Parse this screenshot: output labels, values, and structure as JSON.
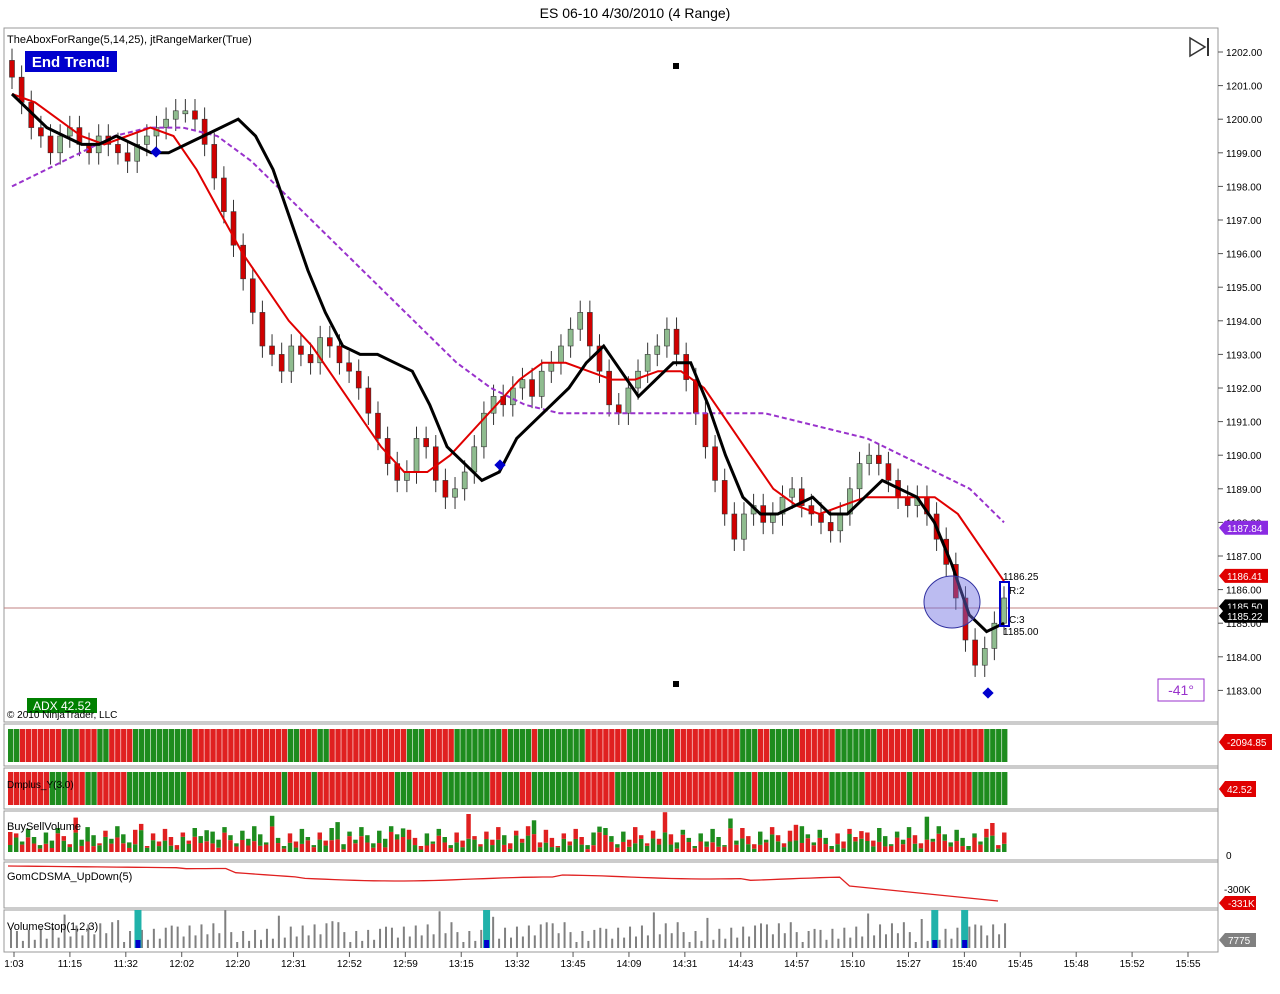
{
  "window": {
    "title": "ES 06-10  4/30/2010 (4 Range)"
  },
  "main_panel": {
    "indicator_label": "TheAboxForRange(5,14,25), jtRangeMarker(True)",
    "end_trend_badge": "End Trend!",
    "adx_badge": "ADX 42.52",
    "copyright": "© 2010 NinjaTrader, LLC",
    "angle_label": "-41°",
    "range_box": {
      "high_label": "1186.25",
      "r_label": "R:2",
      "c_label": "C:3",
      "low_label": "1185.00"
    }
  },
  "price_axis": {
    "ticks": [
      "1202.00",
      "1201.00",
      "1200.00",
      "1199.00",
      "1198.00",
      "1197.00",
      "1196.00",
      "1195.00",
      "1194.00",
      "1193.00",
      "1192.00",
      "1191.00",
      "1190.00",
      "1189.00",
      "1188.00",
      "1187.00",
      "1186.00",
      "1185.00",
      "1184.00",
      "1183.00"
    ],
    "markers": [
      {
        "label": "1187.84",
        "color": "#8a2be2"
      },
      {
        "label": "1186.41",
        "color": "#e00000"
      },
      {
        "label": "1185.50",
        "color": "#000000"
      },
      {
        "label": "1185.22",
        "color": "#000000"
      }
    ]
  },
  "time_axis": {
    "ticks": [
      "1:03",
      "11:15",
      "11:32",
      "12:02",
      "12:20",
      "12:31",
      "12:52",
      "12:59",
      "13:15",
      "13:32",
      "13:45",
      "14:09",
      "14:31",
      "14:43",
      "14:57",
      "15:10",
      "15:27",
      "15:40",
      "15:45",
      "15:48",
      "15:52",
      "15:55"
    ]
  },
  "sub_panels": [
    {
      "label": "",
      "value_label": "-2094.85",
      "value_color": "#e00000"
    },
    {
      "label": "Dmplus_Y(3.0)",
      "value_label": "42.52",
      "value_color": "#e00000"
    },
    {
      "label": "BuySellVolume",
      "value_label": "0",
      "value_color": ""
    },
    {
      "label": "GomCDSMA_UpDown(5)",
      "value_label": "-331K",
      "value_color": "#e00000",
      "extra_label": "-300K"
    },
    {
      "label": "VolumeStop(1,2,3)",
      "value_label": "7775",
      "value_color": "#808080"
    }
  ],
  "colors": {
    "up": "#8fbc8f",
    "down": "#d00000",
    "fast_ma": "#000000",
    "mid_ma": "#e00000",
    "slow_ma": "#9932cc",
    "vwap": "#0000cd",
    "green_bar": "#1e8c1e",
    "red_bar": "#e02020",
    "teal": "#20b2aa"
  },
  "chart_data": {
    "type": "candlestick",
    "title": "ES 06-10  4/30/2010 (4 Range)",
    "ylim": [
      1182.5,
      1202.25
    ],
    "close_path": [
      1201.25,
      1200.5,
      1199.75,
      1199.5,
      1199.0,
      1199.5,
      1199.75,
      1199.25,
      1199.0,
      1199.5,
      1199.25,
      1199.0,
      1198.75,
      1199.25,
      1199.5,
      1199.75,
      1200.0,
      1200.25,
      1200.25,
      1200.0,
      1199.25,
      1198.25,
      1197.25,
      1196.25,
      1195.25,
      1194.25,
      1193.25,
      1193.0,
      1192.5,
      1193.25,
      1193.0,
      1192.75,
      1193.5,
      1193.25,
      1192.75,
      1192.5,
      1192.0,
      1191.25,
      1190.5,
      1189.75,
      1189.25,
      1189.5,
      1190.5,
      1190.25,
      1189.25,
      1188.75,
      1189.0,
      1189.5,
      1190.25,
      1191.25,
      1191.75,
      1191.5,
      1192.0,
      1192.25,
      1191.75,
      1192.5,
      1192.75,
      1193.25,
      1193.75,
      1194.25,
      1193.25,
      1192.5,
      1191.5,
      1191.25,
      1192.0,
      1192.5,
      1193.0,
      1193.25,
      1193.75,
      1193.0,
      1192.25,
      1191.25,
      1190.25,
      1189.25,
      1188.25,
      1187.5,
      1188.25,
      1188.5,
      1188.0,
      1188.25,
      1188.75,
      1189.0,
      1188.5,
      1188.25,
      1188.0,
      1187.75,
      1188.25,
      1189.0,
      1189.75,
      1190.0,
      1189.75,
      1189.25,
      1188.75,
      1188.5,
      1188.75,
      1188.25,
      1187.5,
      1186.75,
      1185.75,
      1184.5,
      1183.75,
      1184.25,
      1185.0,
      1185.75
    ],
    "ma_fast": [
      1200.75,
      1200.25,
      1199.75,
      1199.5,
      1199.25,
      1199.25,
      1199.5,
      1199.25,
      1199.0,
      1199.0,
      1199.25,
      1199.5,
      1199.75,
      1200.0,
      1199.5,
      1198.5,
      1197.0,
      1195.5,
      1194.25,
      1193.25,
      1193.0,
      1193.0,
      1192.75,
      1192.5,
      1191.5,
      1190.25,
      1189.75,
      1189.25,
      1189.5,
      1190.5,
      1191.0,
      1191.5,
      1192.0,
      1192.75,
      1193.25,
      1192.5,
      1191.75,
      1192.25,
      1192.75,
      1192.75,
      1191.5,
      1190.0,
      1188.75,
      1188.25,
      1188.25,
      1188.5,
      1188.75,
      1188.25,
      1188.25,
      1188.75,
      1189.25,
      1189.0,
      1188.75,
      1188.0,
      1186.75,
      1185.25,
      1184.75,
      1185.0
    ],
    "ma_mid": [
      1200.75,
      1200.5,
      1200.0,
      1199.5,
      1199.25,
      1199.5,
      1199.75,
      1199.5,
      1198.5,
      1197.25,
      1196.0,
      1195.0,
      1194.0,
      1193.25,
      1192.25,
      1191.25,
      1190.25,
      1189.5,
      1189.5,
      1190.0,
      1190.75,
      1191.5,
      1192.25,
      1192.75,
      1192.75,
      1192.5,
      1192.25,
      1192.25,
      1192.5,
      1192.5,
      1192.0,
      1191.0,
      1190.0,
      1189.0,
      1188.5,
      1188.25,
      1188.5,
      1188.75,
      1188.75,
      1188.75,
      1188.75,
      1188.25,
      1187.25,
      1186.25
    ],
    "ma_slow": [
      1198.0,
      1198.5,
      1199.0,
      1199.5,
      1199.75,
      1199.75,
      1199.5,
      1198.75,
      1197.75,
      1196.75,
      1195.75,
      1194.75,
      1193.75,
      1192.75,
      1192.0,
      1191.5,
      1191.25,
      1191.25,
      1191.25,
      1191.25,
      1191.25,
      1191.25,
      1191.25,
      1191.0,
      1190.75,
      1190.5,
      1190.0,
      1189.5,
      1189.0,
      1188.0
    ],
    "volume_stop_spikes": [
      0.13,
      0.48,
      0.93,
      0.96
    ]
  }
}
